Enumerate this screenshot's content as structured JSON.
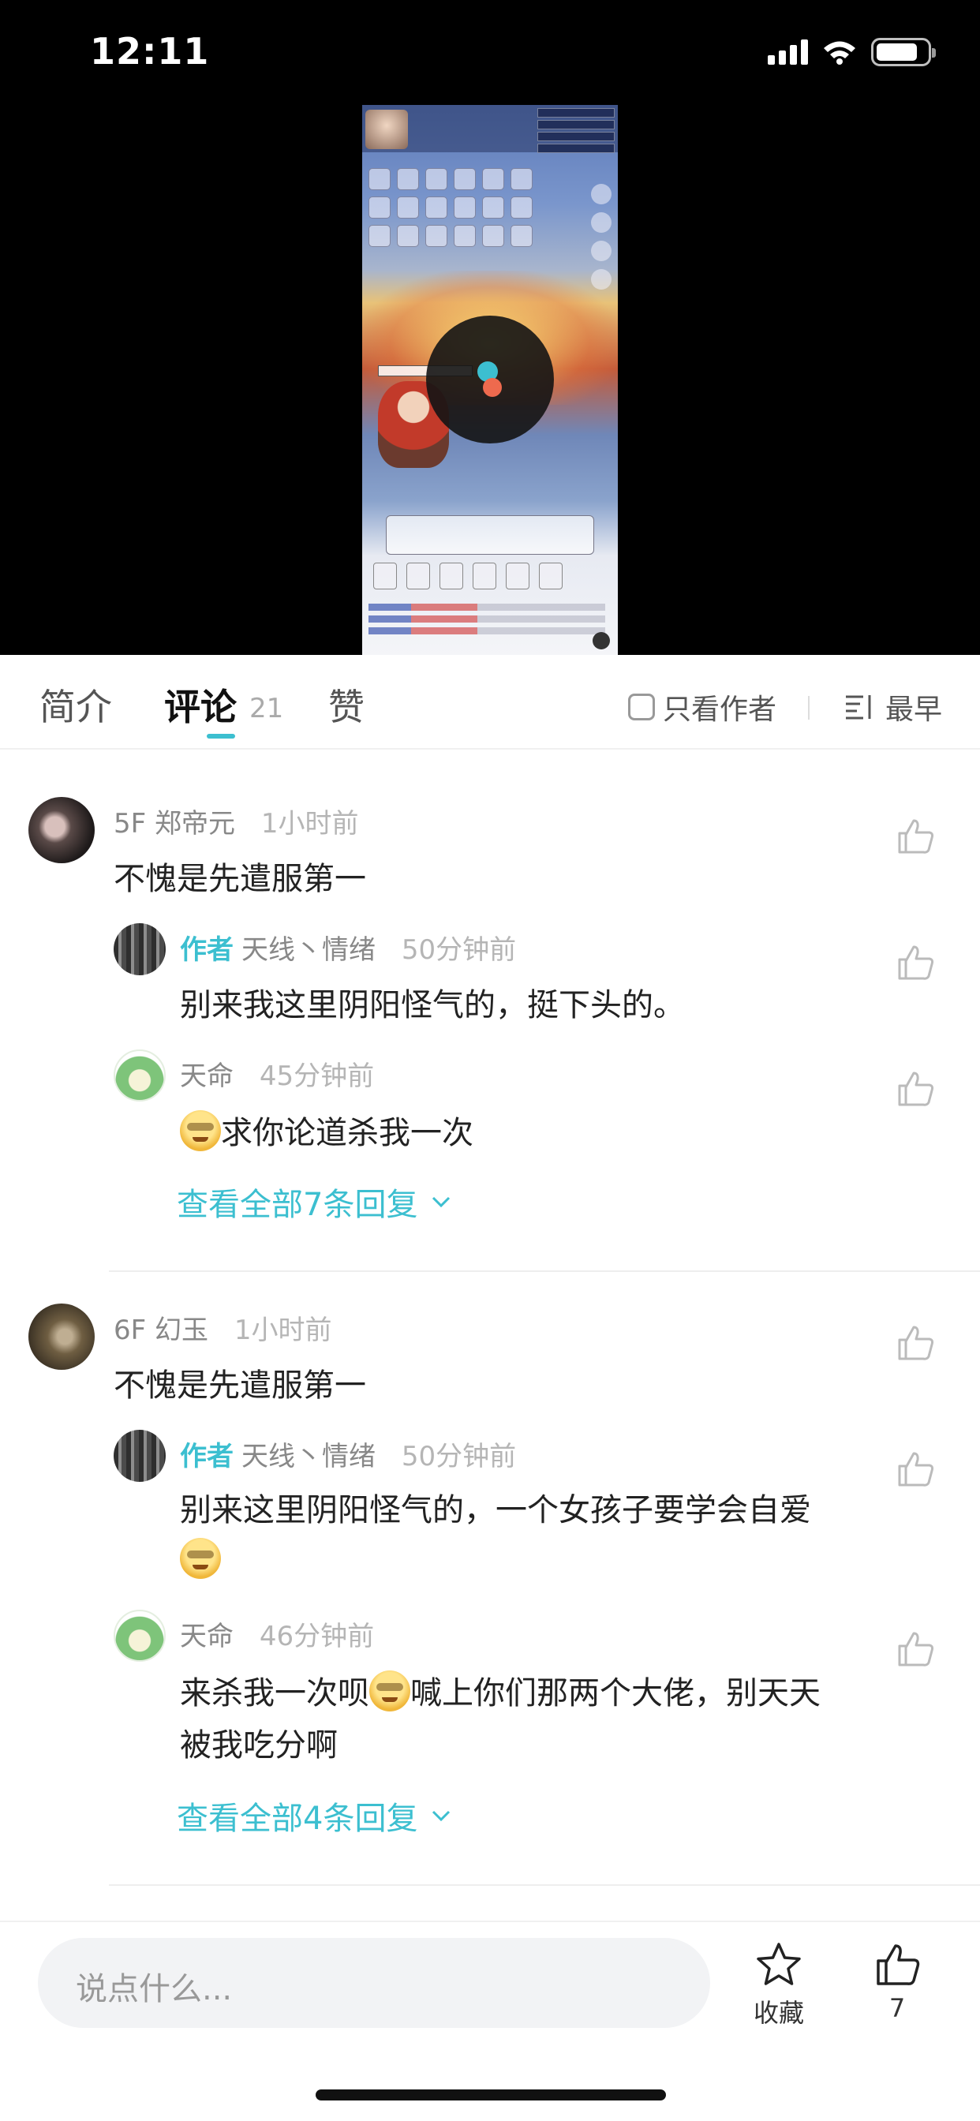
{
  "status_bar": {
    "time": "12:11"
  },
  "tabs": {
    "intro": "简介",
    "comments": "评论",
    "comments_count": "21",
    "likes": "赞",
    "author_only": "只看作者",
    "sort": "最早"
  },
  "comments": [
    {
      "floor": "5F",
      "user": "郑帝元",
      "time": "1小时前",
      "text": "不愧是先遣服第一",
      "replies": [
        {
          "author_tag": "作者",
          "user": "天线丶情绪",
          "time": "50分钟前",
          "text": "别来我这里阴阳怪气的，挺下头的。"
        },
        {
          "user": "天命",
          "time": "45分钟前",
          "text": "求你论道杀我一次"
        }
      ],
      "view_all": "查看全部7条回复"
    },
    {
      "floor": "6F",
      "user": "幻玉",
      "time": "1小时前",
      "text": "不愧是先遣服第一",
      "replies": [
        {
          "author_tag": "作者",
          "user": "天线丶情绪",
          "time": "50分钟前",
          "text": "别来这里阴阳怪气的，一个女孩子要学会自爱"
        },
        {
          "user": "天命",
          "time": "46分钟前",
          "text_line1_a": "来杀我一次呗",
          "text_line1_b": "喊上你们那两个大佬，别天天",
          "text_line2": "被我吃分啊"
        }
      ],
      "view_all": "查看全部4条回复"
    }
  ],
  "bottom_bar": {
    "input_placeholder": "说点什么...",
    "favorite_label": "收藏",
    "like_count": "7"
  },
  "colors": {
    "accent": "#3cbfd0",
    "video_bg": "#000000",
    "text_secondary": "#888888"
  },
  "icons": [
    "signal-icon",
    "wifi-icon",
    "battery-icon",
    "checkbox-icon",
    "sort-icon",
    "thumbs-up-icon",
    "chevron-down-icon",
    "star-icon",
    "emoji-icon"
  ]
}
